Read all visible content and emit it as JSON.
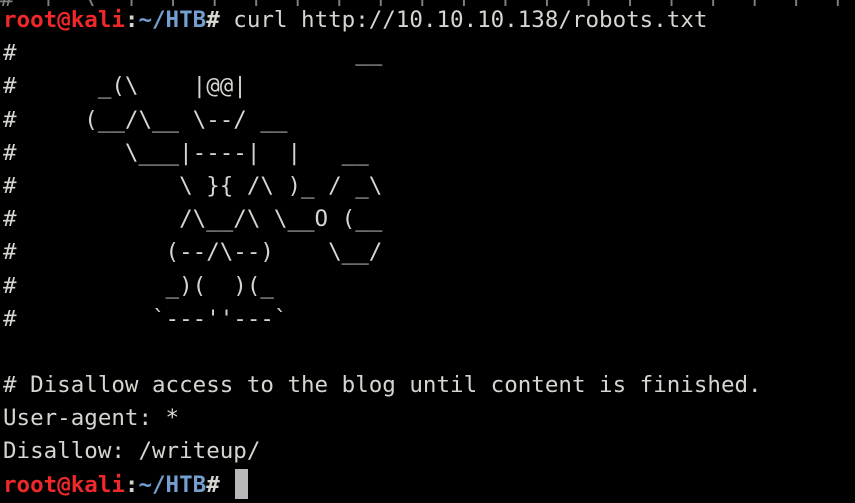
{
  "terminal": {
    "scrolled_text": "#  |  \\  |  |  |  |  |  |  |  |  |  |  |  |  |  |  |  |  |  |  |",
    "prompt": {
      "user_host": "root@kali",
      "colon": ":",
      "path": "~/HTB",
      "symbol": "#"
    },
    "command": " curl http://10.10.10.138/robots.txt",
    "output": [
      "#                         __",
      "#      _(\\    |@@|",
      "#     (__/\\__ \\--/ __",
      "#        \\___|----|  |   __",
      "#            \\ }{ /\\ )_ / _\\",
      "#            /\\__/\\ \\__O (__",
      "#           (--/\\--)    \\__/",
      "#           _)(  )(_",
      "#          `---''---`",
      "",
      "# Disallow access to the blog until content is finished.",
      "User-agent: *",
      "Disallow: /writeup/"
    ],
    "final_prompt": {
      "user_host": "root@kali",
      "colon": ":",
      "path": "~/HTB",
      "symbol": "#"
    },
    "colors": {
      "background": "#000000",
      "foreground": "#d3d7cf",
      "user_host": "#ef2929",
      "path": "#729fcf",
      "cursor": "#b8b8b8"
    }
  }
}
